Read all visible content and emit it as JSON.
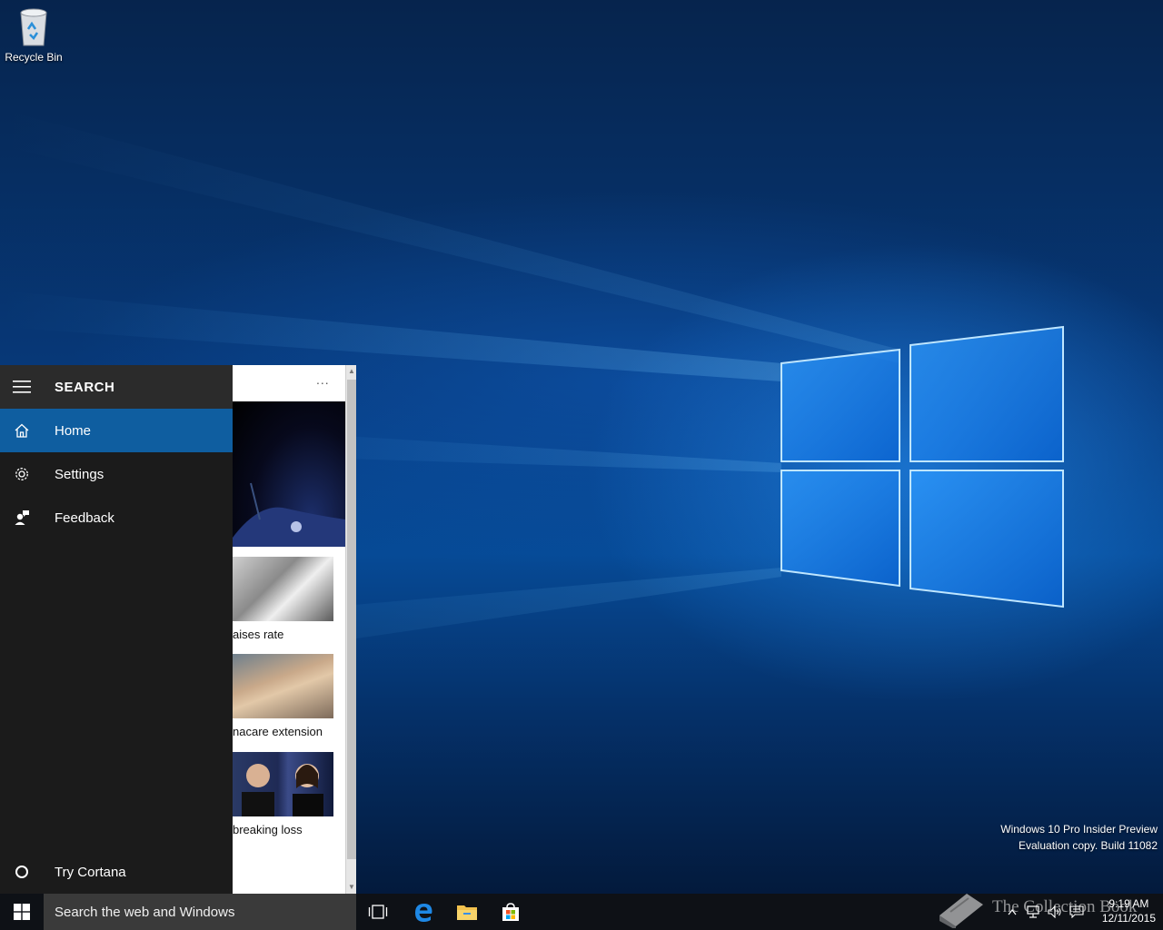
{
  "desktop": {
    "icons": [
      {
        "label": "Recycle Bin",
        "icon": "recycle-bin-icon"
      }
    ],
    "watermark": {
      "line1": "Windows 10 Pro Insider Preview",
      "line2": "Evaluation copy. Build 11082"
    }
  },
  "search_panel": {
    "title": "SEARCH",
    "menu": [
      {
        "label": "Home",
        "icon": "home-icon",
        "selected": true
      },
      {
        "label": "Settings",
        "icon": "gear-icon",
        "selected": false
      },
      {
        "label": "Feedback",
        "icon": "feedback-icon",
        "selected": false
      }
    ],
    "footer": {
      "label": "Try Cortana",
      "icon": "cortana-circle-icon"
    }
  },
  "news": {
    "more_label": "...",
    "captions": [
      "aises rate",
      "nacare extension",
      "breaking loss"
    ]
  },
  "taskbar": {
    "search_placeholder": "Search the web and Windows",
    "pinned": [
      "task-view-icon",
      "edge-icon",
      "file-explorer-icon",
      "store-icon"
    ],
    "clock": {
      "time": "9:19 AM",
      "date": "12/11/2015"
    },
    "overlay_text": "The Collection Book"
  },
  "colors": {
    "accent": "#0f5ea0",
    "panel_bg": "#1b1b1b",
    "taskbar_bg": "#0e1116"
  }
}
